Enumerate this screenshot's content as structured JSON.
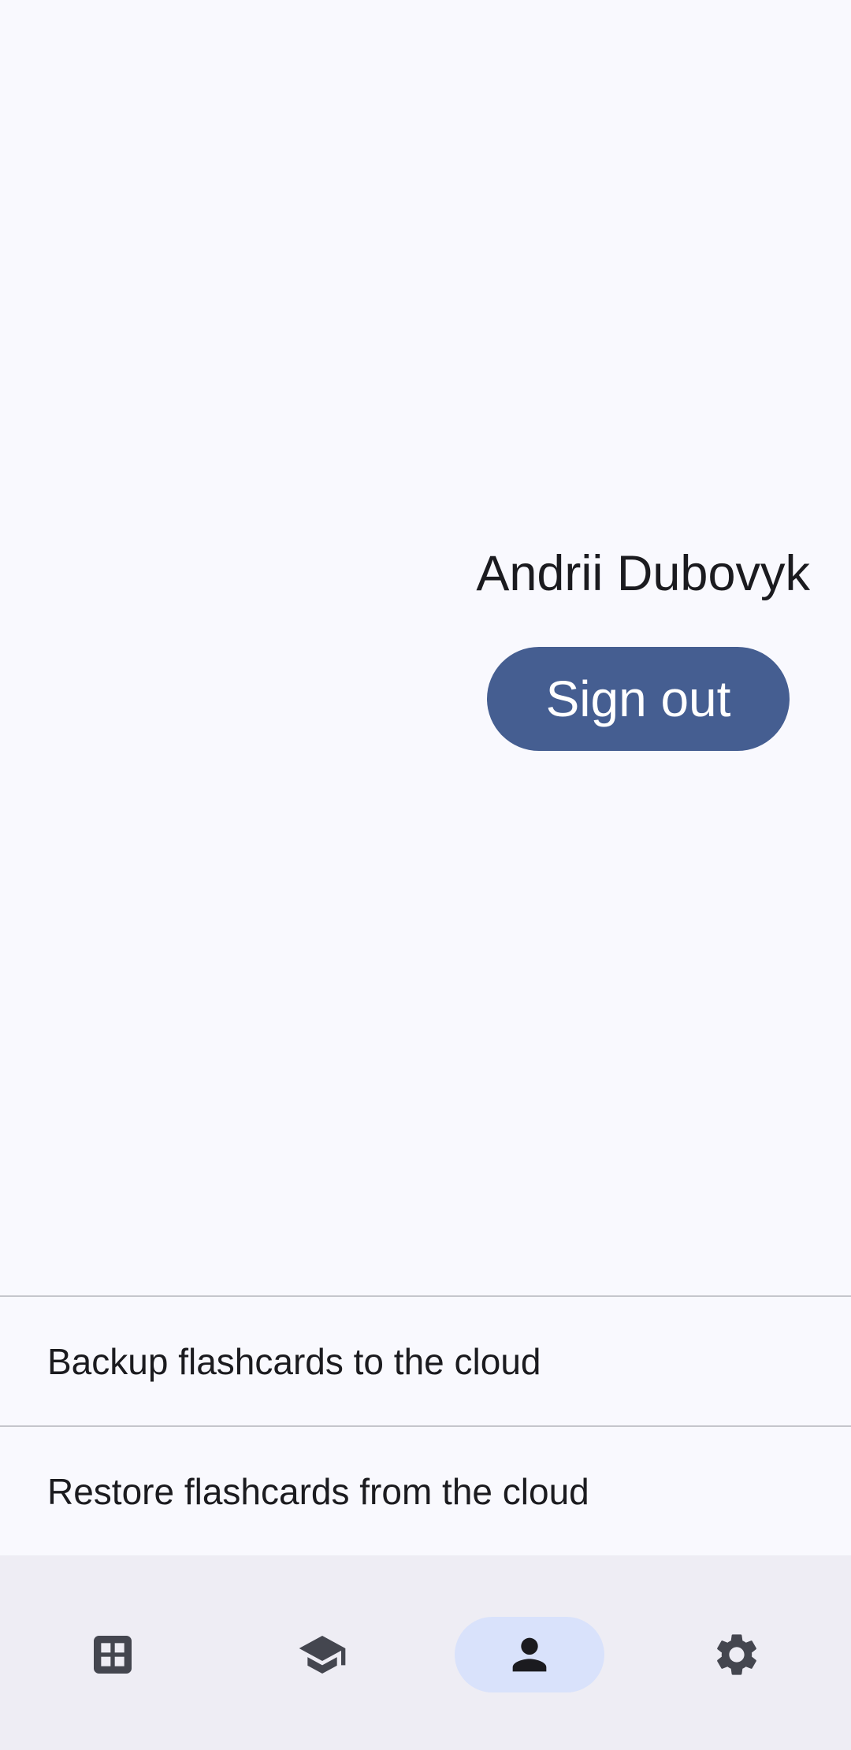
{
  "profile": {
    "user_name": "Andrii Dubovyk",
    "sign_out_label": "Sign out"
  },
  "actions": {
    "items": [
      {
        "label": "Backup flashcards to the cloud"
      },
      {
        "label": "Restore flashcards from the cloud"
      }
    ]
  },
  "bottom_nav": {
    "items": [
      {
        "icon": "dashboard-icon",
        "active": false
      },
      {
        "icon": "school-icon",
        "active": false
      },
      {
        "icon": "person-icon",
        "active": true
      },
      {
        "icon": "gear-icon",
        "active": false
      }
    ]
  },
  "colors": {
    "accent": "#455e91",
    "background": "#f9f9fe",
    "nav_background": "#eeedf4",
    "nav_active_indicator": "#d9e2fb",
    "icon": "#44464f"
  }
}
